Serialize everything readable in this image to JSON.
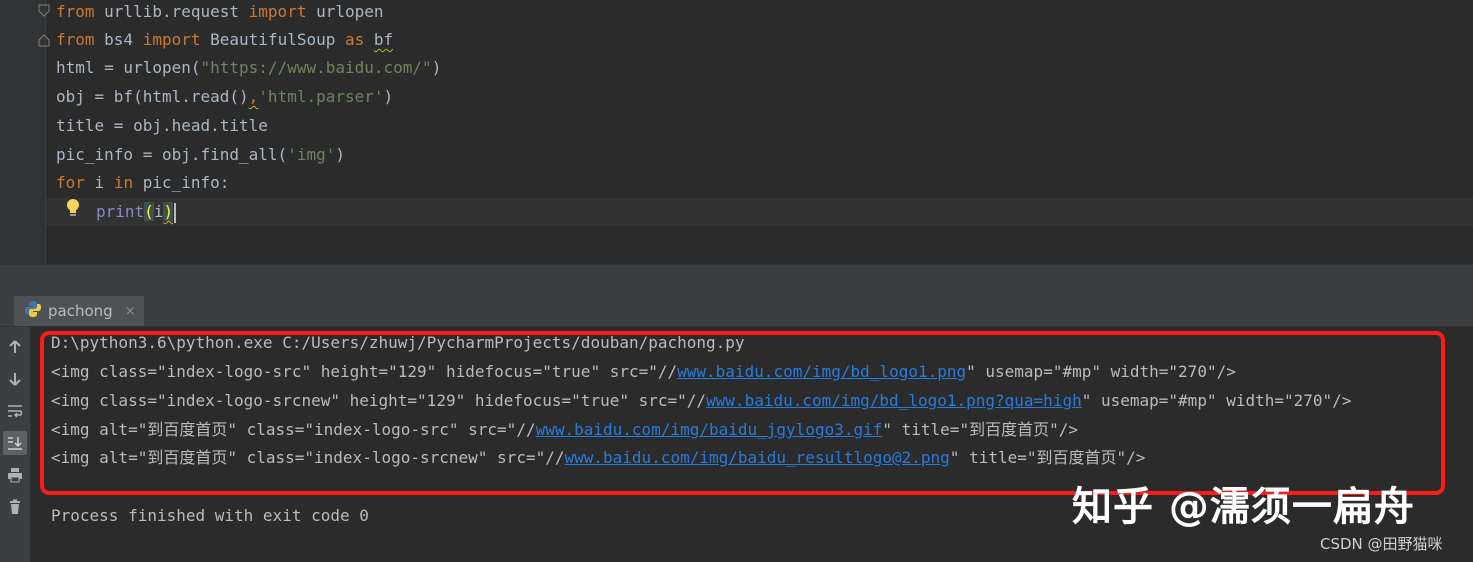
{
  "editor": {
    "line1": {
      "kw1": "from",
      "mod": " urllib.request ",
      "kw2": "import",
      "name": " urlopen"
    },
    "line2": {
      "kw1": "from",
      "mod": " bs4 ",
      "kw2": "import",
      "name": " BeautifulSoup ",
      "kw3": "as",
      "sp": " ",
      "alias": "bf"
    },
    "line3": {
      "a": "html = urlopen(",
      "s": "\"https://www.baidu.com/\"",
      "b": ")"
    },
    "line4": {
      "a": "obj = bf(html.read()",
      "comma": ",",
      "s": "'html.parser'",
      "b": ")"
    },
    "line5": {
      "a": "title = obj.head.title"
    },
    "line6": {
      "a": "pic_info = obj.find_all(",
      "s": "'img'",
      "b": ")"
    },
    "line7": {
      "kw1": "for",
      "a": " i ",
      "kw2": "in",
      "b": " pic_info:"
    },
    "line8": {
      "fn": "print",
      "open": "(",
      "arg": "i",
      "close": ")"
    }
  },
  "run": {
    "tab_label": "pachong",
    "close_symbol": "×",
    "toolbar_icons": [
      "arrow-up-icon",
      "arrow-down-icon",
      "soft-wrap-icon",
      "scroll-to-end-icon",
      "print-icon",
      "trash-icon"
    ]
  },
  "console": {
    "cmd": "D:\\python3.6\\python.exe C:/Users/zhuwj/PycharmProjects/douban/pachong.py",
    "out1": {
      "pre": "<img class=\"index-logo-src\" height=\"129\" hidefocus=\"true\" src=\"//",
      "link": "www.baidu.com/img/bd_logo1.png",
      "post": "\" usemap=\"#mp\" width=\"270\"/>"
    },
    "out2": {
      "pre": "<img class=\"index-logo-srcnew\" height=\"129\" hidefocus=\"true\" src=\"//",
      "link": "www.baidu.com/img/bd_logo1.png?qua=high",
      "post": "\" usemap=\"#mp\" width=\"270\"/>"
    },
    "out3": {
      "pre": "<img alt=\"到百度首页\" class=\"index-logo-src\" src=\"//",
      "link": "www.baidu.com/img/baidu_jgylogo3.gif",
      "post": "\" title=\"到百度首页\"/>"
    },
    "out4": {
      "pre": "<img alt=\"到百度首页\" class=\"index-logo-srcnew\" src=\"//",
      "link": "www.baidu.com/img/baidu_resultlogo@2.png",
      "post": "\" title=\"到百度首页\"/>"
    },
    "exit": "Process finished with exit code 0"
  },
  "watermark": "知乎 @濡须一扁舟",
  "csdn": "CSDN @田野猫咪",
  "colors": {
    "highlight_box": "#ff1a1a",
    "link": "#287bde",
    "keyword": "#cc7832",
    "string": "#6a8759"
  }
}
